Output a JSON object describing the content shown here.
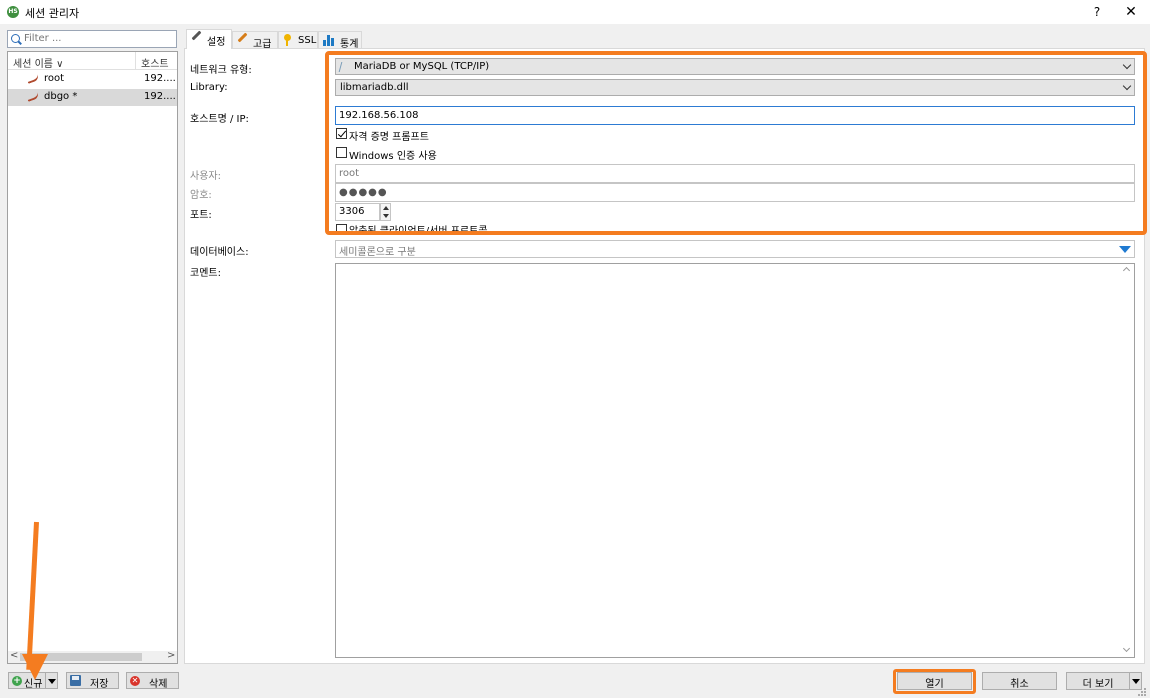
{
  "window": {
    "title": "세션 관리자",
    "help": "?",
    "close": "✕"
  },
  "left_panel": {
    "filter_placeholder": "Filter ...",
    "columns": {
      "name": "세션 이름 ∨",
      "host": "호스트"
    },
    "sessions": [
      {
        "name": "root",
        "host": "192...."
      },
      {
        "name": "dbgo *",
        "host": "192....",
        "selected": true
      }
    ]
  },
  "bottom_left": {
    "new": "신규",
    "save": "저장",
    "delete": "삭제"
  },
  "tabs": [
    {
      "label": "설정",
      "icon": "wrench-icon",
      "active": true
    },
    {
      "label": "고급",
      "icon": "wrench-icon"
    },
    {
      "label": "SSL",
      "icon": "key-icon"
    },
    {
      "label": "통계",
      "icon": "bar-chart-icon"
    }
  ],
  "form": {
    "network_type_label": "네트워크 유형:",
    "network_type_value": "MariaDB or MySQL (TCP/IP)",
    "library_label": "Library:",
    "library_value": "libmariadb.dll",
    "host_label": "호스트명 / IP:",
    "host_value": "192.168.56.108",
    "prompt_credentials": "자격 증명 프롬프트",
    "windows_auth": "Windows 인증 사용",
    "user_label": "사용자:",
    "user_value": "root",
    "password_label": "암호:",
    "password_value": "●●●●●",
    "port_label": "포트:",
    "port_value": "3306",
    "compressed_protocol": "압축된 클라이언트/서버 프로토콜",
    "database_label": "데이터베이스:",
    "database_placeholder": "세미콜론으로 구분",
    "comment_label": "코멘트:"
  },
  "bottom_right": {
    "open": "열기",
    "cancel": "취소",
    "more": "더 보기"
  },
  "colors": {
    "annotation": "#f47c20",
    "focus": "#2d7bd3",
    "db_arrow": "#1f7ad1"
  }
}
